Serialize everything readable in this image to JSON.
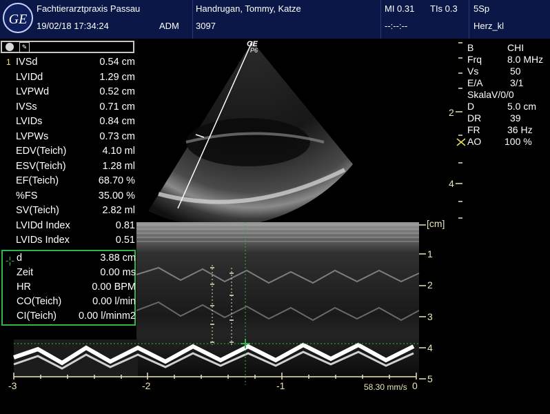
{
  "header": {
    "logo": "GE",
    "clinic": "Fachtierarztpraxis Passau",
    "datetime": "19/02/18 17:34:24",
    "operator": "ADM",
    "patient": "Handrugan, Tommy, Katze",
    "patient_id": "3097",
    "mi": "MI 0.31",
    "tis": "TIs 0.3",
    "time_field": "--:--:--",
    "probe": "5Sp",
    "preset": "Herz_kl"
  },
  "probe_label": {
    "brand": "GE",
    "probe": "P6"
  },
  "measurements": [
    {
      "index": "1",
      "label": "IVSd",
      "value": "0.54 cm"
    },
    {
      "index": "",
      "label": "LVIDd",
      "value": "1.29 cm"
    },
    {
      "index": "",
      "label": "LVPWd",
      "value": "0.52 cm"
    },
    {
      "index": "",
      "label": "IVSs",
      "value": "0.71 cm"
    },
    {
      "index": "",
      "label": "LVIDs",
      "value": "0.84 cm"
    },
    {
      "index": "",
      "label": "LVPWs",
      "value": "0.73 cm"
    },
    {
      "index": "",
      "label": "EDV(Teich)",
      "value": "4.10 ml"
    },
    {
      "index": "",
      "label": "ESV(Teich)",
      "value": "1.28 ml"
    },
    {
      "index": "",
      "label": "EF(Teich)",
      "value": "68.70 %"
    },
    {
      "index": "",
      "label": "%FS",
      "value": "35.00 %"
    },
    {
      "index": "",
      "label": "SV(Teich)",
      "value": "2.82 ml"
    },
    {
      "index": "",
      "label": "LVIDd Index",
      "value": "0.81"
    },
    {
      "index": "",
      "label": "LVIDs Index",
      "value": "0.51"
    }
  ],
  "distance": [
    {
      "label": "d",
      "value": "3.88 cm"
    },
    {
      "label": "Zeit",
      "value": "0.00 ms"
    },
    {
      "label": "HR",
      "value": "0.00 BPM"
    },
    {
      "label": "CO(Teich)",
      "value": "0.00 l/min"
    },
    {
      "label": "CI(Teich)",
      "value": "0.00 l/minm2"
    }
  ],
  "params": [
    {
      "label": "B",
      "value": "CHI"
    },
    {
      "label": "Frq",
      "value": "8.0 MHz"
    },
    {
      "label": "Vs",
      "value": "50"
    },
    {
      "label": "E/A",
      "value": "3/1"
    },
    {
      "label": "SkalaV/0/0",
      "value": ""
    },
    {
      "label": "D",
      "value": "5.0 cm"
    },
    {
      "label": "DR",
      "value": "39"
    },
    {
      "label": "FR",
      "value": "36 Hz"
    },
    {
      "label": "AO",
      "value": "100 %"
    }
  ],
  "bmode_depth": [
    "2",
    "4"
  ],
  "mmode_unit": "[cm]",
  "mmode_depth": [
    "1",
    "2",
    "3",
    "4",
    "5"
  ],
  "time_axis": [
    "-3",
    "-2",
    "-1",
    "0"
  ],
  "sweep_speed": "58.30 mm/s",
  "colors": {
    "header_bg": "#0b1847",
    "accent_green": "#2fb848",
    "marker_yellow": "#e9e6b8"
  }
}
